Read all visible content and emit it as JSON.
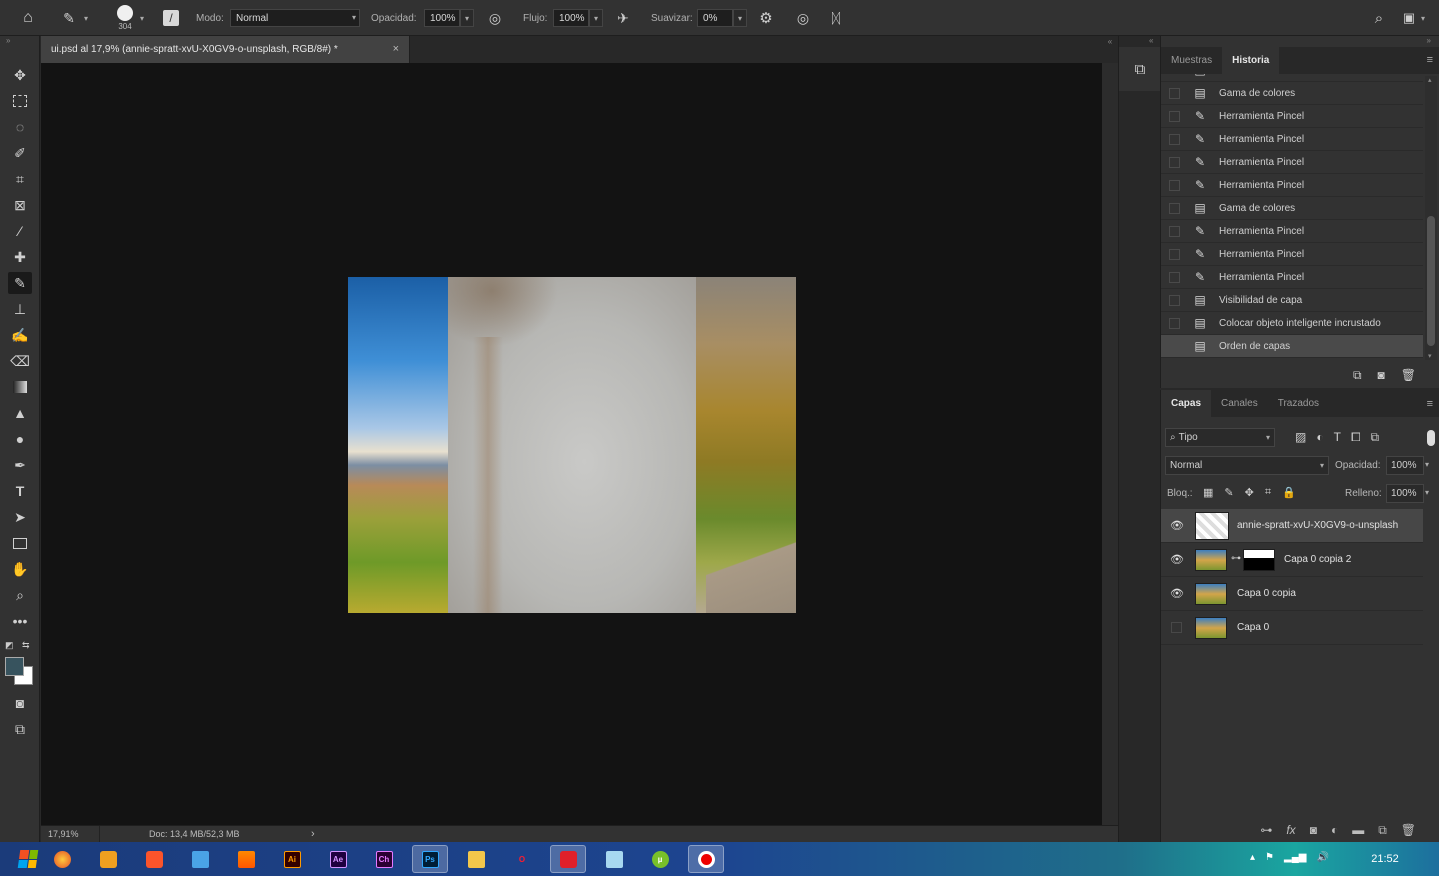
{
  "optionsbar": {
    "brush_size": "304",
    "mode_label": "Modo:",
    "mode_value": "Normal",
    "opacity_label": "Opacidad:",
    "opacity_value": "100%",
    "flow_label": "Flujo:",
    "flow_value": "100%",
    "smooth_label": "Suavizar:",
    "smooth_value": "0%"
  },
  "document": {
    "tab_title": "ui.psd al 17,9% (annie-spratt-xvU-X0GV9-o-unsplash, RGB/8#) *",
    "close": "×"
  },
  "status": {
    "zoom": "17,91%",
    "doc_size": "Doc: 13,4 MB/52,3 MB",
    "arrow": "›"
  },
  "history": {
    "tabs": [
      "Muestras",
      "Historia"
    ],
    "items": [
      {
        "label": "Gama de colores",
        "icon": "document-icon"
      },
      {
        "label": "Herramienta Pincel",
        "icon": "brush-icon"
      },
      {
        "label": "Herramienta Pincel",
        "icon": "brush-icon"
      },
      {
        "label": "Herramienta Pincel",
        "icon": "brush-icon"
      },
      {
        "label": "Herramienta Pincel",
        "icon": "brush-icon"
      },
      {
        "label": "Gama de colores",
        "icon": "document-icon"
      },
      {
        "label": "Herramienta Pincel",
        "icon": "brush-icon"
      },
      {
        "label": "Herramienta Pincel",
        "icon": "brush-icon"
      },
      {
        "label": "Herramienta Pincel",
        "icon": "brush-icon"
      },
      {
        "label": "Visibilidad de capa",
        "icon": "document-icon"
      },
      {
        "label": "Colocar objeto inteligente incrustado",
        "icon": "document-icon"
      },
      {
        "label": "Orden de capas",
        "icon": "document-icon",
        "selected": true
      }
    ]
  },
  "layers": {
    "tabs": [
      "Capas",
      "Canales",
      "Trazados"
    ],
    "filter": "Tipo",
    "blend_mode": "Normal",
    "opacity_label": "Opacidad:",
    "opacity_value": "100%",
    "lock_label": "Bloq.:",
    "fill_label": "Relleno:",
    "fill_value": "100%",
    "items": [
      {
        "name": "annie-spratt-xvU-X0GV9-o-unsplash",
        "visible": true,
        "selected": true,
        "kind": "smart-object"
      },
      {
        "name": "Capa 0 copia 2",
        "visible": true,
        "selected": false,
        "kind": "masked"
      },
      {
        "name": "Capa 0 copia",
        "visible": true,
        "selected": false,
        "kind": "image"
      },
      {
        "name": "Capa 0",
        "visible": false,
        "selected": false,
        "kind": "image"
      }
    ]
  },
  "taskbar": {
    "apps": [
      "firefox-icon",
      "app-icon",
      "brave-icon",
      "calculator-icon",
      "vlc-icon",
      "Ai",
      "Ae",
      "Ch",
      "Ps",
      "explorer-icon",
      "opera-icon",
      "app-red-icon",
      "notes-icon",
      "utorrent-icon",
      "record-icon"
    ],
    "clock": "21:52"
  },
  "colors": {
    "foreground": "#37535e",
    "background": "#ffffff",
    "accent": "#1473e6"
  }
}
